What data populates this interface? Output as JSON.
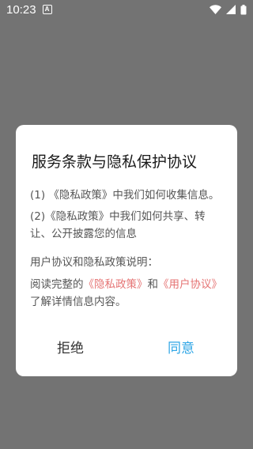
{
  "status_bar": {
    "time": "10:23",
    "icons": [
      "a-badge-icon",
      "wifi-icon",
      "signal-icon",
      "battery-icon"
    ]
  },
  "dialog": {
    "title": "服务条款与隐私保护协议",
    "item1": "(1) 《隐私政策》中我们如何收集信息。",
    "item2": "(2)《隐私政策》中我们如何共享、转让、公开披露您的信息",
    "explain_heading": "用户协议和隐私政策说明：",
    "read_prefix": "阅读完整的",
    "privacy_link": "《隐私政策》",
    "and": "和",
    "user_link": "《用户协议》",
    "read_suffix": "了解详情信息内容。",
    "reject_label": "拒绝",
    "agree_label": "同意"
  },
  "colors": {
    "overlay": "#737373",
    "link": "#e57373",
    "accent": "#2fa6e6"
  }
}
